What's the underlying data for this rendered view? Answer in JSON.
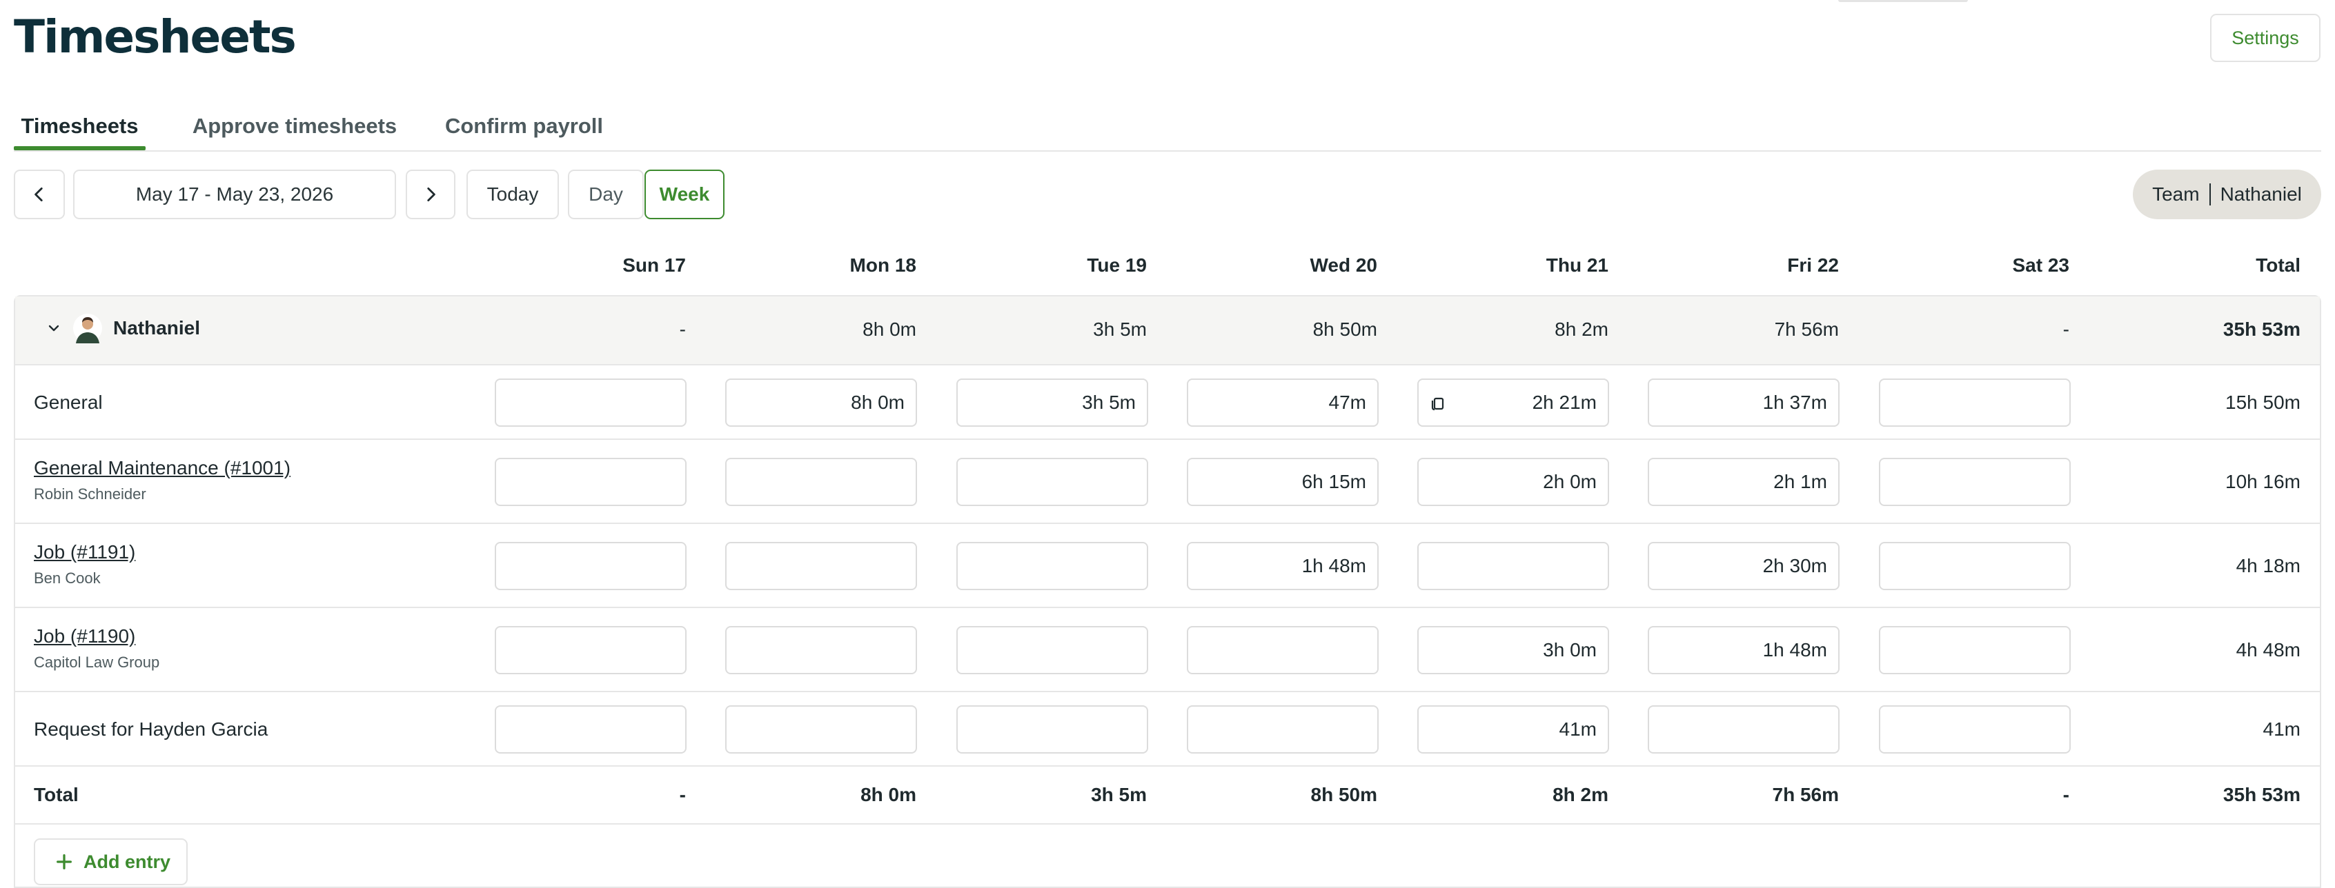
{
  "page_title": "Timesheets",
  "settings_label": "Settings",
  "tabs": [
    "Timesheets",
    "Approve timesheets",
    "Confirm payroll"
  ],
  "toolbar": {
    "date_range": "May 17 - May 23, 2026",
    "today": "Today",
    "day": "Day",
    "week": "Week",
    "view_team": "Team",
    "view_person": "Nathaniel"
  },
  "days": [
    "Sun 17",
    "Mon 18",
    "Tue 19",
    "Wed 20",
    "Thu 21",
    "Fri 22",
    "Sat 23"
  ],
  "total_header": "Total",
  "person": {
    "name": "Nathaniel",
    "daily": [
      "-",
      "8h 0m",
      "3h 5m",
      "8h 50m",
      "8h 2m",
      "7h 56m",
      "-"
    ],
    "total": "35h 53m"
  },
  "rows": [
    {
      "label": "General",
      "sub": "",
      "link": false,
      "cells": [
        "",
        "8h 0m",
        "3h 5m",
        "47m",
        "2h 21m",
        "1h 37m",
        ""
      ],
      "total": "15h 50m"
    },
    {
      "label": "General Maintenance (#1001)",
      "sub": "Robin Schneider",
      "link": true,
      "cells": [
        "",
        "",
        "",
        "6h 15m",
        "2h 0m",
        "2h 1m",
        ""
      ],
      "total": "10h 16m"
    },
    {
      "label": "Job (#1191)",
      "sub": "Ben Cook",
      "link": true,
      "cells": [
        "",
        "",
        "",
        "1h 48m",
        "",
        "2h 30m",
        ""
      ],
      "total": "4h 18m"
    },
    {
      "label": "Job (#1190)",
      "sub": "Capitol Law Group",
      "link": true,
      "cells": [
        "",
        "",
        "",
        "",
        "3h 0m",
        "1h 48m",
        ""
      ],
      "total": "4h 48m"
    },
    {
      "label": "Request for Hayden Garcia",
      "sub": "",
      "link": false,
      "cells": [
        "",
        "",
        "",
        "",
        "41m",
        "",
        ""
      ],
      "total": "41m"
    }
  ],
  "totals": {
    "label": "Total",
    "daily": [
      "-",
      "8h 0m",
      "3h 5m",
      "8h 50m",
      "8h 2m",
      "7h 56m",
      "-"
    ],
    "total": "35h 53m"
  },
  "add_entry_label": "Add entry",
  "colors": {
    "accent": "#3d8b2f",
    "title": "#0e2f3a",
    "person_row_bg": "#f5f5f3",
    "toggle_bg": "#e4e2dc"
  },
  "icons": [
    "chevron-left-icon",
    "chevron-right-icon",
    "chevron-down-icon",
    "avatar",
    "note-icon",
    "plus-icon"
  ]
}
